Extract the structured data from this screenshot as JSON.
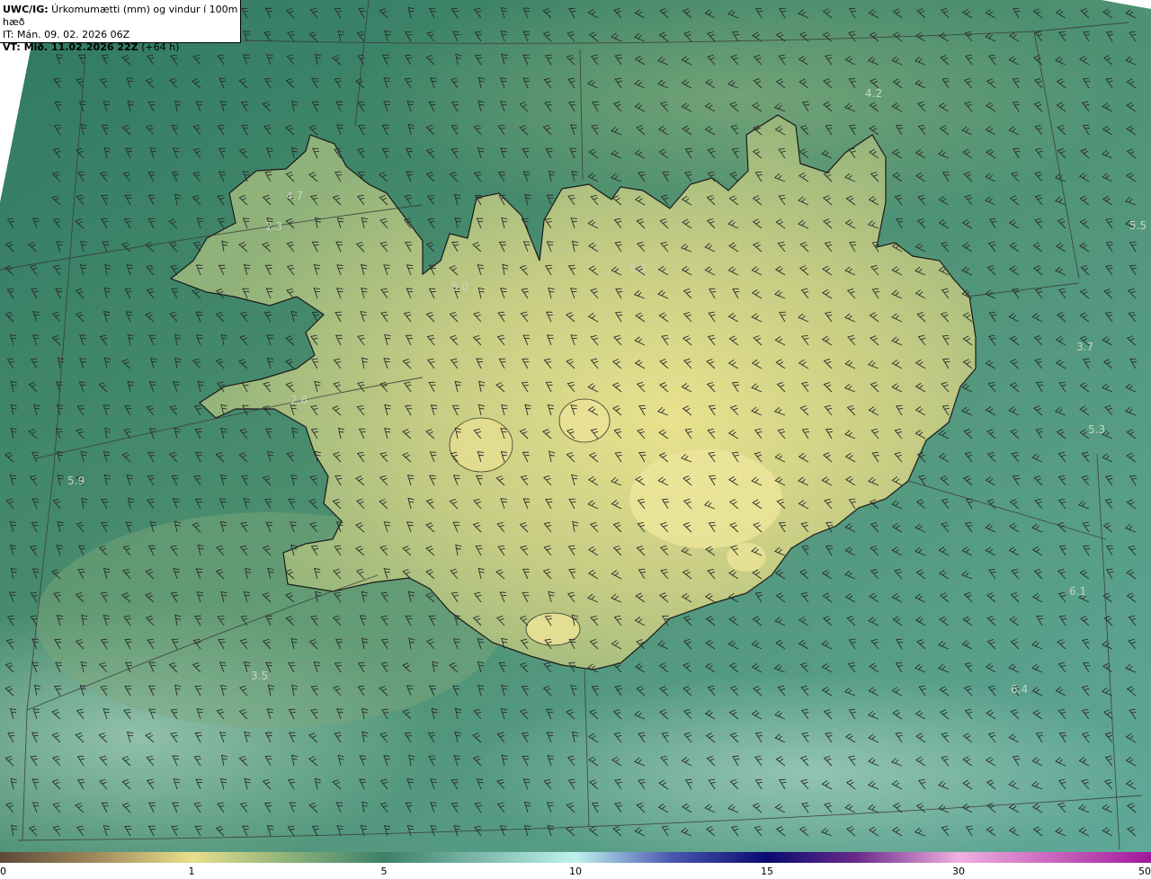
{
  "header": {
    "title_bold": "UWC/IG:",
    "title_rest": " Úrkomumætti (mm) og vindur í 100m hæð",
    "init_time": "IT: Mán. 09. 02. 2026 06Z",
    "valid_bold": "VT: Mið. 11.02.2026 22Z",
    "valid_rest": " (+64 h)"
  },
  "colorbar": {
    "ticks": [
      {
        "label": "0",
        "value": 0
      },
      {
        "label": "1",
        "value": 1
      },
      {
        "label": "5",
        "value": 5
      },
      {
        "label": "10",
        "value": 10
      },
      {
        "label": "15",
        "value": 15
      },
      {
        "label": "30",
        "value": 30
      },
      {
        "label": "50",
        "value": 50
      }
    ],
    "stops": [
      {
        "value": 0,
        "color": "#5c4a3a"
      },
      {
        "value": 0.5,
        "color": "#a08a5c"
      },
      {
        "value": 1,
        "color": "#e8df8c"
      },
      {
        "value": 3,
        "color": "#8fb27a"
      },
      {
        "value": 5,
        "color": "#3c8068"
      },
      {
        "value": 10,
        "color": "#bff2ee"
      },
      {
        "value": 12.5,
        "color": "#4a58b0"
      },
      {
        "value": 15,
        "color": "#0a0a70"
      },
      {
        "value": 22,
        "color": "#6a2a8a"
      },
      {
        "value": 30,
        "color": "#f0b0e0"
      },
      {
        "value": 50,
        "color": "#a0189a"
      }
    ]
  },
  "value_labels": [
    {
      "text": "4.2"
    },
    {
      "text": "4.7"
    },
    {
      "text": "2.3"
    },
    {
      "text": "5.0"
    },
    {
      "text": "5.3"
    },
    {
      "text": "5.5"
    },
    {
      "text": "3.7"
    },
    {
      "text": "2.6"
    },
    {
      "text": "5.3"
    },
    {
      "text": "5.9"
    },
    {
      "text": "6.1"
    },
    {
      "text": "3.5"
    },
    {
      "text": "6.4"
    }
  ],
  "colors": {
    "ocean": "#3f8a6e",
    "land_low": "#8fb27a",
    "land_high": "#e6e08c",
    "coast": "#1a1a1a",
    "grid": "#3a3a3a"
  }
}
